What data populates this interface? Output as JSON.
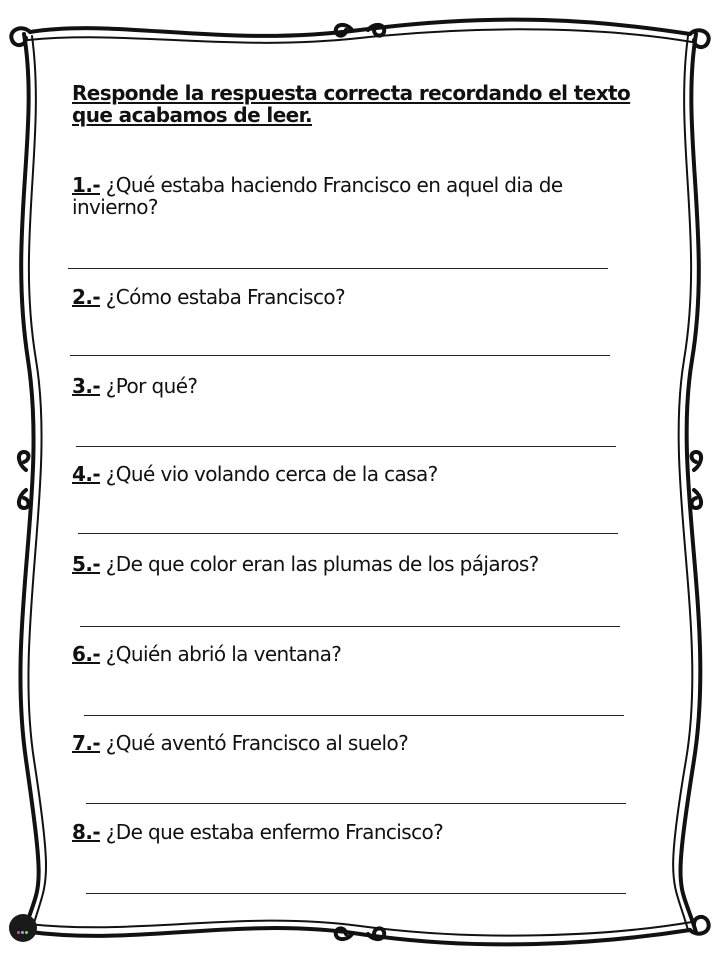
{
  "instructions": "Responde la respuesta correcta recordando el texto que acabamos de leer.",
  "questions": [
    {
      "number": "1.-",
      "text": " ¿Qué estaba haciendo Francisco en aquel dia de invierno?"
    },
    {
      "number": "2.-",
      "text": " ¿Cómo estaba Francisco?"
    },
    {
      "number": "3.-",
      "text": " ¿Por qué?"
    },
    {
      "number": "4.-",
      "text": " ¿Qué vio volando cerca de la casa?"
    },
    {
      "number": "5.-",
      "text": " ¿De que color eran las plumas de los pájaros?"
    },
    {
      "number": "6.-",
      "text": " ¿Quién abrió la ventana?"
    },
    {
      "number": "7.-",
      "text": " ¿Qué aventó Francisco al suelo?"
    },
    {
      "number": "8.-",
      "text": " ¿De que estaba enfermo Francisco?"
    }
  ],
  "colors": {
    "frame": "#111111",
    "text": "#111111",
    "logo_bg": "#1a1a1a"
  },
  "icons": {
    "logo": "publisher-logo-badge",
    "frame": "wavy-border"
  }
}
